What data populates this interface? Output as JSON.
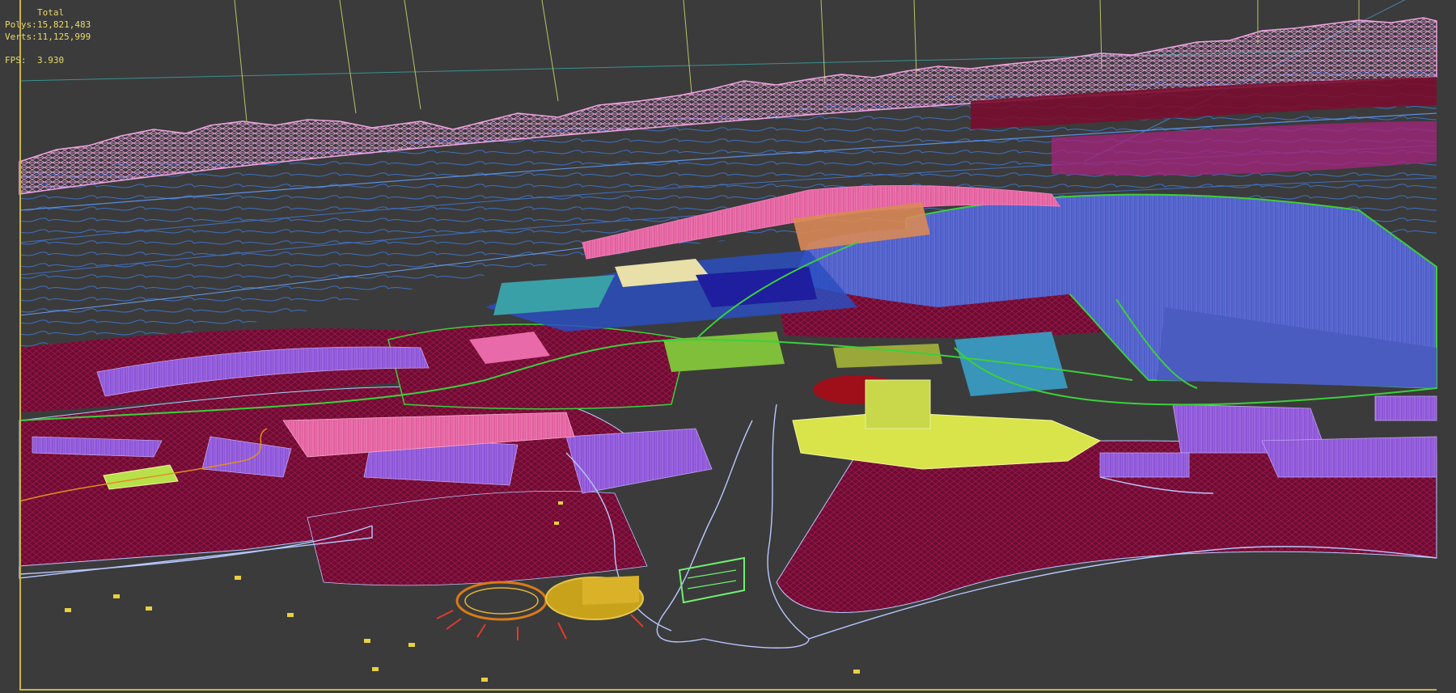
{
  "viewport": {
    "label": "3D wireframe perspective viewport",
    "background_color": "#3b3b3b",
    "frame_color": "#c8b54a"
  },
  "stats": {
    "total_label": "Total",
    "polys_label": "Polys:",
    "polys_value": "15,821,483",
    "verts_label": "Verts:",
    "verts_value": "11,125,999",
    "fps_label": "FPS:",
    "fps_value": "3.930",
    "text_color": "#e8d96a"
  },
  "scene_colors": {
    "terrain_mountains": "#e58fd6",
    "water_contours": "#4a7fd6",
    "ground_mesh": "#8a1040",
    "buildings_blue": "#5a6ad8",
    "buildings_purple": "#9a5ce0",
    "buildings_pink": "#e85fa8",
    "buildings_yellow": "#d8e44a",
    "roads_green": "#3ccf3c",
    "outlines_lightblue": "#b8c8ff",
    "stadium_gold": "#c9a21c",
    "grid_lines": "#d6e37a"
  }
}
